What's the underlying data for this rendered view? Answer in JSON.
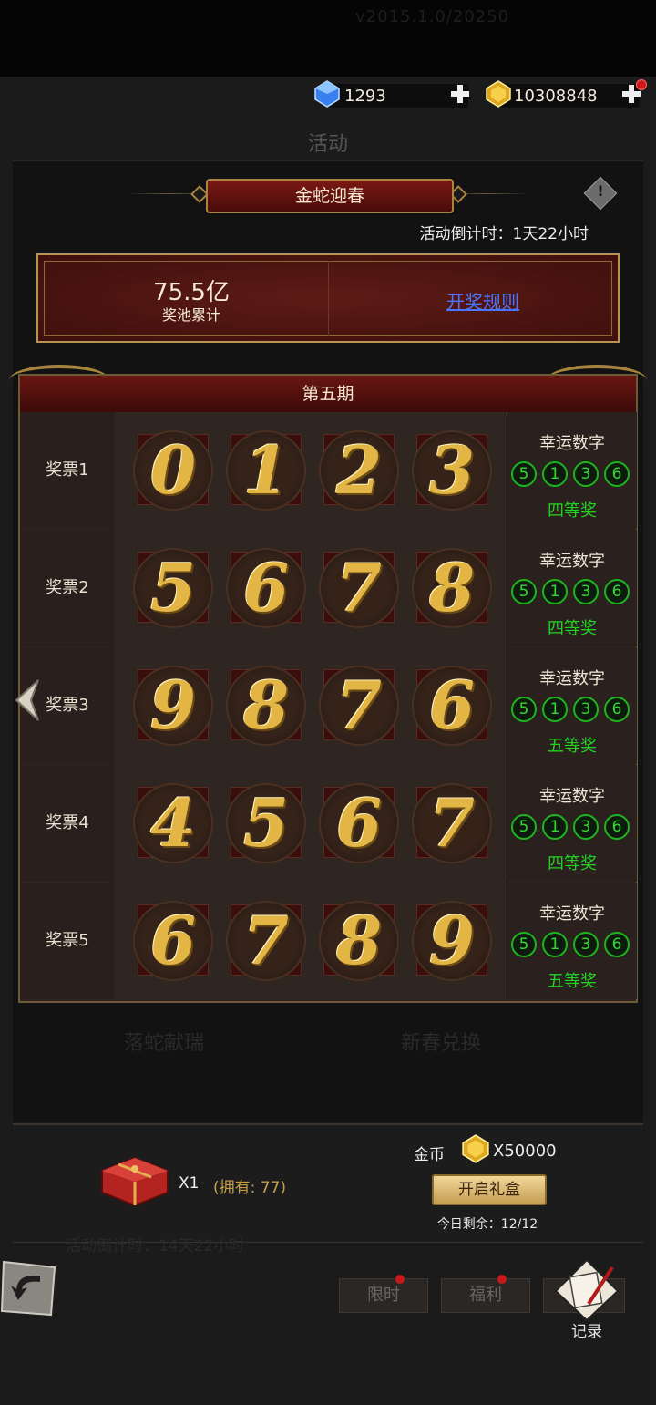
{
  "top_ghost_text": "v2015.1.0/20250",
  "currency": {
    "diamonds": "1293",
    "gold": "10308848"
  },
  "page_title": "活动",
  "event": {
    "title": "金蛇迎春",
    "info_icon": "!",
    "countdown": "活动倒计时：1天22小时",
    "pool_value": "75.5亿",
    "pool_label": "奖池累计",
    "rules_link": "开奖规则"
  },
  "phase": "第五期",
  "lucky_title": "幸运数字",
  "lucky_numbers": [
    "5",
    "1",
    "3",
    "6"
  ],
  "tickets": [
    {
      "label": "奖票1",
      "digits": [
        "0",
        "1",
        "2",
        "3"
      ],
      "prize": "四等奖"
    },
    {
      "label": "奖票2",
      "digits": [
        "5",
        "6",
        "7",
        "8"
      ],
      "prize": "四等奖"
    },
    {
      "label": "奖票3",
      "digits": [
        "9",
        "8",
        "7",
        "6"
      ],
      "prize": "五等奖"
    },
    {
      "label": "奖票4",
      "digits": [
        "4",
        "5",
        "6",
        "7"
      ],
      "prize": "四等奖"
    },
    {
      "label": "奖票5",
      "digits": [
        "6",
        "7",
        "8",
        "9"
      ],
      "prize": "五等奖"
    }
  ],
  "background_ghost": {
    "left_tab": "落蛇献瑞",
    "right_tab": "新春兑换",
    "countdown": "活动倒计时：14天22小时"
  },
  "reward": {
    "count": "X1",
    "owned": "(拥有: 77)",
    "coin_label": "金币",
    "coin_amount": "X50000",
    "open_button": "开启礼盒",
    "remaining": "今日剩余：12/12"
  },
  "nav": {
    "limited": "限时",
    "welfare": "福利",
    "record": "记录"
  },
  "colors": {
    "gold": "#e2b545",
    "green_lucky": "#22d322",
    "dark_red": "#5e1b16",
    "link_blue": "#4b74ff"
  }
}
